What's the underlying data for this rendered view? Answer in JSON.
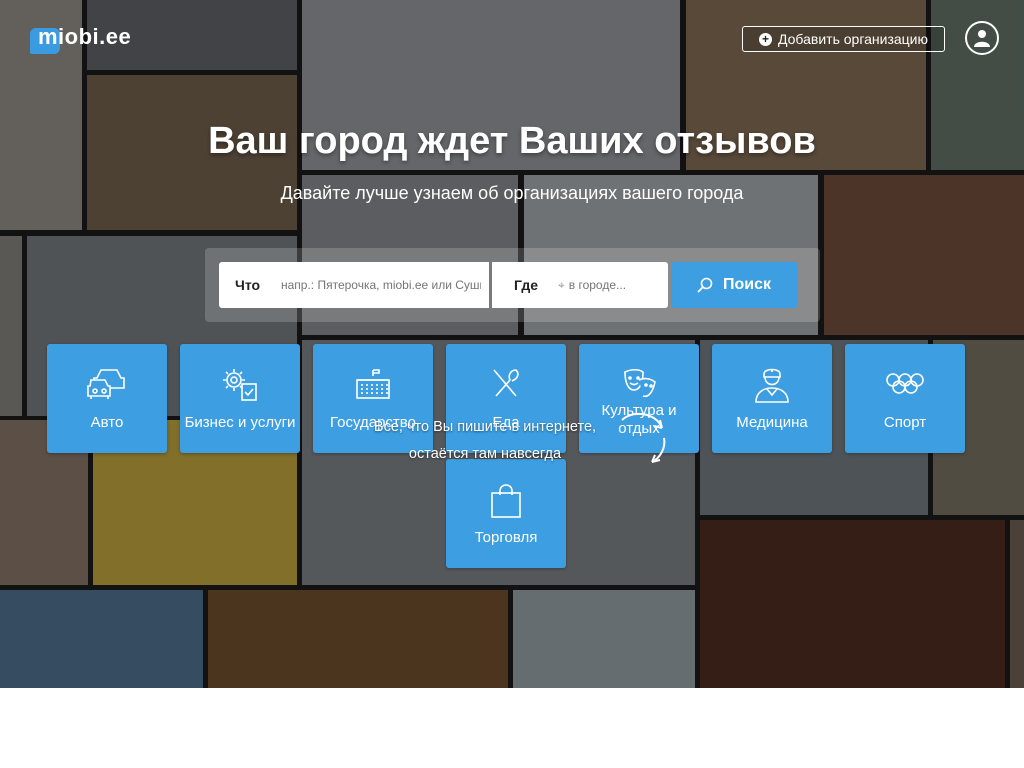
{
  "brand": {
    "logo_text": "miobi.ee",
    "accent": "#3d9fe2"
  },
  "header": {
    "add_org_label": "Добавить организацию",
    "add_org_icon": "plus-circle-icon",
    "user_icon": "user-icon"
  },
  "hero": {
    "title": "Ваш город ждет Ваших отзывов",
    "subtitle": "Давайте лучше узнаем об организациях вашего города"
  },
  "search": {
    "what_label": "Что",
    "what_placeholder": "напр.: Пятерочка, miobi.ee или Суши",
    "where_label": "Где",
    "where_placeholder": "в городе...",
    "button_label": "Поиск",
    "button_icon": "search-icon"
  },
  "categories": [
    {
      "label": "Авто",
      "icon": "cars-icon"
    },
    {
      "label": "Бизнес и услуги",
      "icon": "gears-document-icon"
    },
    {
      "label": "Государство",
      "icon": "government-building-icon"
    },
    {
      "label": "Еда",
      "icon": "fork-knife-icon"
    },
    {
      "label": "Культура и отдых",
      "icon": "theater-masks-icon"
    },
    {
      "label": "Медицина",
      "icon": "doctor-icon"
    },
    {
      "label": "Спорт",
      "icon": "olympic-rings-icon"
    },
    {
      "label": "Торговля",
      "icon": "shopping-bag-icon"
    }
  ],
  "notice": {
    "line1": "Все, что Вы пишите в интернете,",
    "line2": "остаётся там навсегда"
  }
}
